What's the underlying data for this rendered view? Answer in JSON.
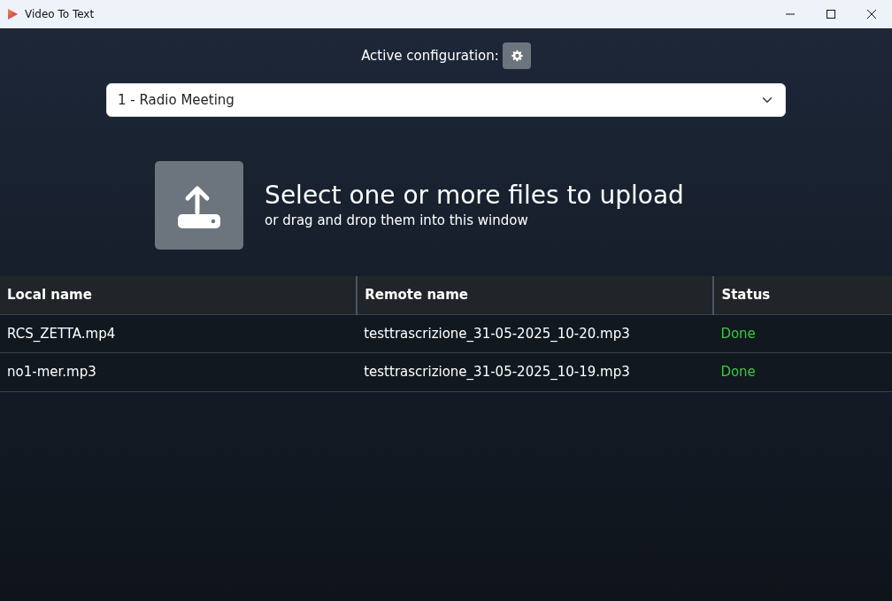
{
  "window": {
    "title": "Video To Text"
  },
  "config": {
    "label": "Active configuration:",
    "selected_value": "1 - Radio Meeting"
  },
  "upload": {
    "title": "Select one or more files to upload",
    "subtitle": "or drag and drop them into this window"
  },
  "table": {
    "columns": [
      "Local name",
      "Remote name",
      "Status"
    ],
    "rows": [
      {
        "local_name": "RCS_ZETTA.mp4",
        "remote_name": "testtrascrizione_31-05-2025_10-20.mp3",
        "status": "Done",
        "color": "#3cc83c"
      },
      {
        "local_name": "no1-mer.mp3",
        "remote_name": "testtrascrizione_31-05-2025_10-19.mp3",
        "status": "Done",
        "color": "#3cc83c"
      }
    ]
  }
}
